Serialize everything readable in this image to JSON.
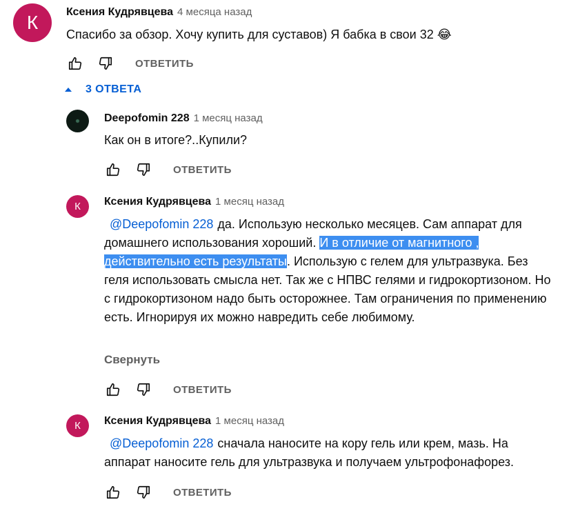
{
  "comment": {
    "avatar_letter": "К",
    "author": "Ксения Кудрявцева",
    "time": "4 месяца назад",
    "text": "Спасибо за обзор. Хочу купить для суставов) Я бабка в свои 32 😂",
    "reply_label": "ОТВЕТИТЬ"
  },
  "replies_toggle": {
    "label": "3 ОТВЕТА"
  },
  "replies": [
    {
      "author": "Deepofomin 228",
      "time": "1 месяц назад",
      "text": "Как он в итоге?..Купили?",
      "reply_label": "ОТВЕТИТЬ"
    },
    {
      "avatar_letter": "К",
      "author": "Ксения Кудрявцева",
      "time": "1 месяц назад",
      "mention": "@Deepofomin 228",
      "text_before": "да. Использую несколько месяцев. Сам аппарат для домашнего использования хороший. ",
      "text_highlight": "И в отличие от магнитного , действительно есть результаты",
      "text_after": ". Использую с гелем для ультразвука. Без геля использовать смысла нет. Так же с НПВС гелями и гидрокортизоном. Но с гидрокортизоном надо быть осторожнее. Там ограничения по применению есть. Игнорируя их можно навредить себе любимому.",
      "collapse_label": "Свернуть",
      "reply_label": "ОТВЕТИТЬ"
    },
    {
      "avatar_letter": "К",
      "author": "Ксения Кудрявцева",
      "time": "1 месяц назад",
      "mention": "@Deepofomin 228",
      "text": "сначала наносите на кору гель или крем, мазь. На аппарат наносите гель для ультразвука и получаем ультрофонафорез.",
      "reply_label": "ОТВЕТИТЬ"
    }
  ],
  "colors": {
    "avatar": "#c2185b",
    "link": "#065fd4",
    "selection": "#3d8ef0",
    "meta": "#606060"
  }
}
